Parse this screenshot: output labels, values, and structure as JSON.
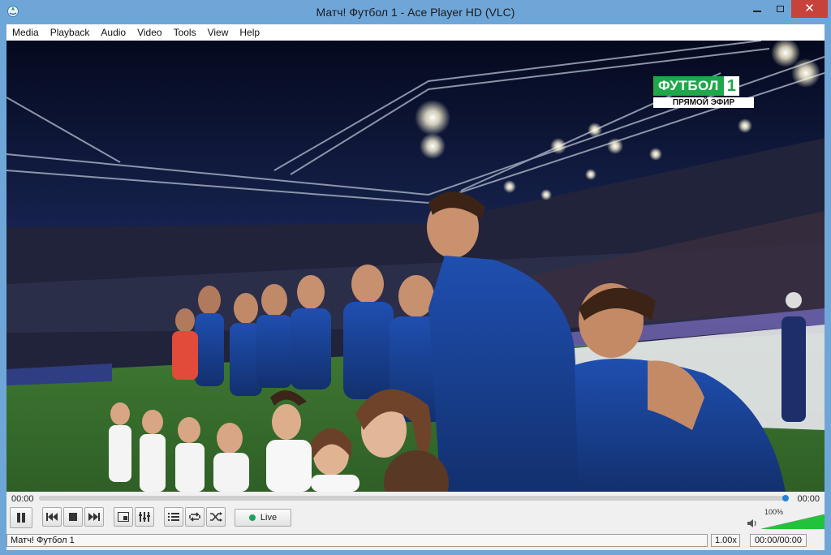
{
  "window": {
    "title": "Матч! Футбол 1 - Ace Player HD (VLC)",
    "close_symbol": "✕"
  },
  "menu": [
    "Media",
    "Playback",
    "Audio",
    "Video",
    "Tools",
    "View",
    "Help"
  ],
  "video": {
    "channel_logo_text": "ФУТБОЛ",
    "channel_logo_number": "1",
    "live_banner": "ПРЯМОЙ ЭФИР"
  },
  "playback": {
    "elapsed": "00:00",
    "remaining": "00:00",
    "seek_position": 1.0,
    "live_label": "Live",
    "volume_label": "100%",
    "volume_level": 1.0
  },
  "status": {
    "stream_name": "Матч! Футбол 1",
    "speed": "1.00x",
    "time": "00:00/00:00"
  },
  "colors": {
    "titlebar": "#6fa6d8",
    "close_button": "#c7423a",
    "seek_handle": "#1f84d6",
    "live_dot": "#1aa35a",
    "volume_fill": "#22c33a",
    "logo_green": "#1fa84a"
  }
}
